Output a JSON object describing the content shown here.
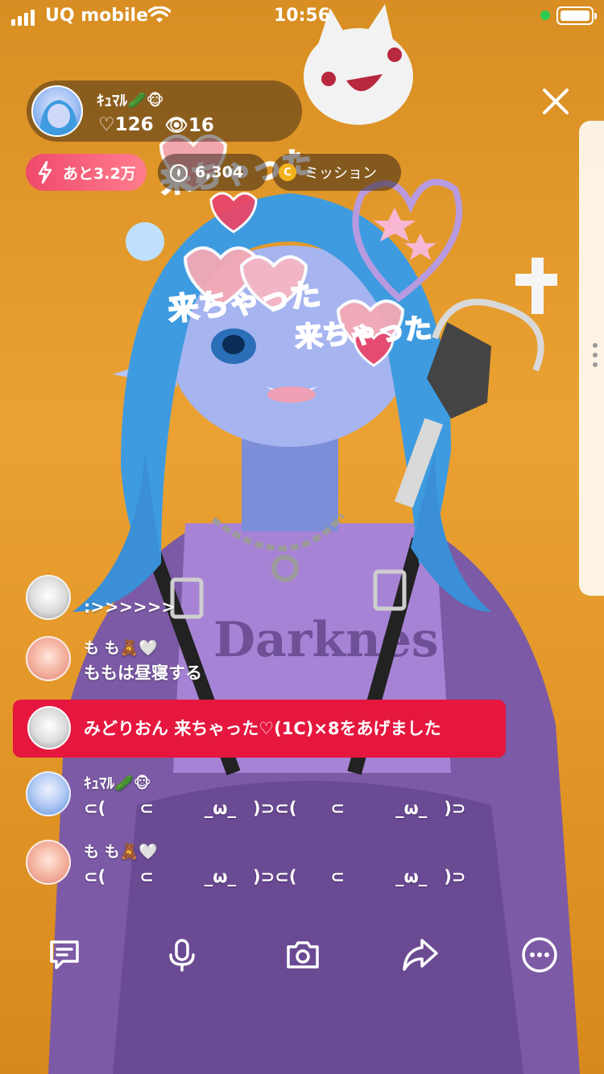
{
  "status_bar": {
    "carrier": "UQ mobile",
    "time": "10:56"
  },
  "host": {
    "name": "ｷｭﾏﾙ🥒🐵",
    "likes": "♡126",
    "viewers": "👁16"
  },
  "boost": {
    "label": "あと3.2万"
  },
  "rank": {
    "label": "6,304"
  },
  "mission": {
    "coin_symbol": "C",
    "label": "ミッション"
  },
  "overlay_stickers": {
    "sticker_text_1": "来ちゃった",
    "sticker_text_2": "来ちゃった",
    "sticker_text_3": "来ちゃった"
  },
  "comments": [
    {
      "name": "",
      "message": ":>>>>>>"
    },
    {
      "name": "も も🧸🤍",
      "message": "ももは昼寝する"
    },
    {
      "name": "ｷｭﾏﾙ🥒🐵",
      "message": "⊂(　　⊂　　　_ω_　)⊃⊂(　　⊂　　　_ω_　)⊃"
    },
    {
      "name": "も も🧸🤍",
      "message": "⊂(　　⊂　　　_ω_　)⊃⊂(　　⊂　　　_ω_　)⊃"
    }
  ],
  "gift_banner": {
    "text": "みどりおん 来ちゃった♡(1C)×8をあげました"
  },
  "bottom_bar": {
    "icons": [
      "comment-icon",
      "microphone-icon",
      "camera-icon",
      "share-icon",
      "more-icon"
    ]
  },
  "colors": {
    "background": "#e39a2e",
    "gift_banner": "#e5173e",
    "boost_gradient_start": "#ef4a6a"
  }
}
